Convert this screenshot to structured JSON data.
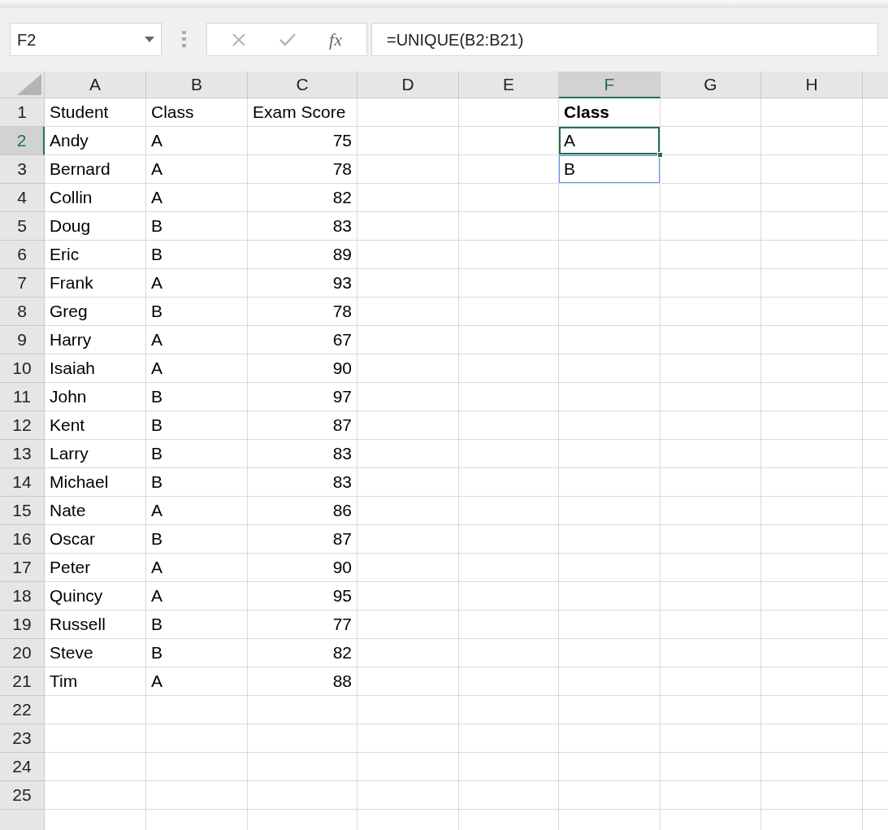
{
  "name_box": {
    "value": "F2"
  },
  "formula_bar": {
    "function_button": "fx",
    "formula": "=UNIQUE(B2:B21)"
  },
  "columns": [
    {
      "label": "A",
      "selected": false
    },
    {
      "label": "B",
      "selected": false
    },
    {
      "label": "C",
      "selected": false
    },
    {
      "label": "D",
      "selected": false
    },
    {
      "label": "E",
      "selected": false
    },
    {
      "label": "F",
      "selected": true
    },
    {
      "label": "G",
      "selected": false
    },
    {
      "label": "H",
      "selected": false
    }
  ],
  "rows": [
    {
      "label": "1",
      "selected": false,
      "a": "Student",
      "b": "Class",
      "c": "Exam Score",
      "f": {
        "text": "Class",
        "bold": true,
        "selected": false,
        "in_spill_range": false
      }
    },
    {
      "label": "2",
      "selected": true,
      "a": "Andy",
      "b": "A",
      "c": "75",
      "f": {
        "text": "A",
        "bold": false,
        "selected": true,
        "in_spill_range": false
      }
    },
    {
      "label": "3",
      "selected": false,
      "a": "Bernard",
      "b": "A",
      "c": "78",
      "f": {
        "text": "B",
        "bold": false,
        "selected": false,
        "in_spill_range": true
      }
    },
    {
      "label": "4",
      "selected": false,
      "a": "Collin",
      "b": "A",
      "c": "82"
    },
    {
      "label": "5",
      "selected": false,
      "a": "Doug",
      "b": "B",
      "c": "83"
    },
    {
      "label": "6",
      "selected": false,
      "a": "Eric",
      "b": "B",
      "c": "89"
    },
    {
      "label": "7",
      "selected": false,
      "a": "Frank",
      "b": "A",
      "c": "93"
    },
    {
      "label": "8",
      "selected": false,
      "a": "Greg",
      "b": "B",
      "c": "78"
    },
    {
      "label": "9",
      "selected": false,
      "a": "Harry",
      "b": "A",
      "c": "67"
    },
    {
      "label": "10",
      "selected": false,
      "a": "Isaiah",
      "b": "A",
      "c": "90"
    },
    {
      "label": "11",
      "selected": false,
      "a": "John",
      "b": "B",
      "c": "97"
    },
    {
      "label": "12",
      "selected": false,
      "a": "Kent",
      "b": "B",
      "c": "87"
    },
    {
      "label": "13",
      "selected": false,
      "a": "Larry",
      "b": "B",
      "c": "83"
    },
    {
      "label": "14",
      "selected": false,
      "a": "Michael",
      "b": "B",
      "c": "83"
    },
    {
      "label": "15",
      "selected": false,
      "a": "Nate",
      "b": "A",
      "c": "86"
    },
    {
      "label": "16",
      "selected": false,
      "a": "Oscar",
      "b": "B",
      "c": "87"
    },
    {
      "label": "17",
      "selected": false,
      "a": "Peter",
      "b": "A",
      "c": "90"
    },
    {
      "label": "18",
      "selected": false,
      "a": "Quincy",
      "b": "A",
      "c": "95"
    },
    {
      "label": "19",
      "selected": false,
      "a": "Russell",
      "b": "B",
      "c": "77"
    },
    {
      "label": "20",
      "selected": false,
      "a": "Steve",
      "b": "B",
      "c": "82"
    },
    {
      "label": "21",
      "selected": false,
      "a": "Tim",
      "b": "A",
      "c": "88"
    },
    {
      "label": "22",
      "selected": false
    },
    {
      "label": "23",
      "selected": false
    },
    {
      "label": "24",
      "selected": false
    },
    {
      "label": "25",
      "selected": false
    }
  ]
}
